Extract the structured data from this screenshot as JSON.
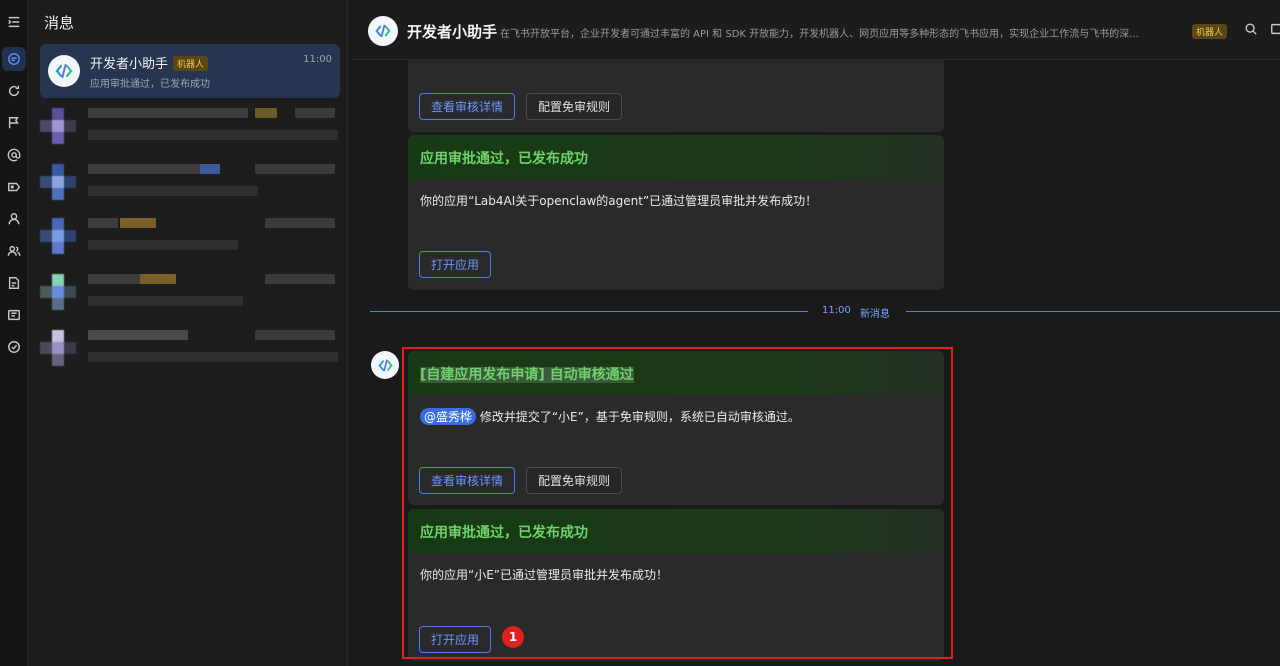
{
  "sidebar": {
    "title": "消息",
    "active_chat": {
      "name": "开发者小助手",
      "badge": "机器人",
      "time": "11:00",
      "preview": "应用审批通过，已发布成功"
    }
  },
  "header": {
    "title": "开发者小助手",
    "description": "在飞书开放平台，企业开发者可通过丰富的 API 和 SDK 开放能力，开发机器人、网页应用等多种形态的飞书应用，实现企业工作流与飞书的深...",
    "badge": "机器人"
  },
  "messages": {
    "top_card": {
      "view_btn": "查看审核详情",
      "config_btn": "配置免审规则"
    },
    "card_prev_success": {
      "title": "应用审批通过，已发布成功",
      "body": "你的应用“Lab4AI关于openclaw的agent”已通过管理员审批并发布成功！",
      "open_btn": "打开应用"
    },
    "divider": {
      "time": "11:00",
      "label": "新消息"
    },
    "card_auto": {
      "title": "[自建应用发布申请] 自动审核通过",
      "mention": "@盛秀桦",
      "body": "修改并提交了“小E”，基于免审规则，系统已自动审核通过。",
      "view_btn": "查看审核详情",
      "config_btn": "配置免审规则"
    },
    "card_new_success": {
      "title": "应用审批通过，已发布成功",
      "body": "你的应用“小E”已通过管理员审批并发布成功！",
      "open_btn": "打开应用"
    }
  },
  "annotation": {
    "marker": "1"
  },
  "colors": {
    "accent": "#4d7cf0",
    "success_title": "#6fd26b",
    "highlight": "#e01f1f",
    "badge_text": "#f2c94c"
  }
}
